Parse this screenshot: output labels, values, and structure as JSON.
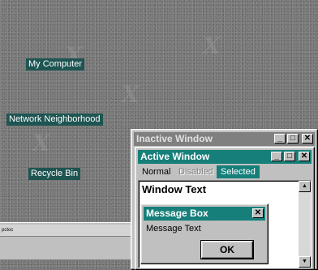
{
  "desktop": {
    "icons": [
      {
        "label": "My Computer"
      },
      {
        "label": "Network Neighborhood"
      },
      {
        "label": "Recycle Bin"
      }
    ],
    "taskbar_text": "pctoc"
  },
  "inactive_window": {
    "title": "Inactive Window"
  },
  "active_window": {
    "title": "Active Window",
    "menu": {
      "normal": "Normal",
      "disabled": "Disabled",
      "selected": "Selected"
    },
    "window_text": "Window Text"
  },
  "message_box": {
    "title": "Message Box",
    "text": "Message Text",
    "ok_label": "OK"
  },
  "colors": {
    "desktop": "#7a7a7a",
    "active_title": "#167f7a",
    "inactive_title": "#808080",
    "selection": "#167f7a",
    "face": "#c0c0c0"
  }
}
